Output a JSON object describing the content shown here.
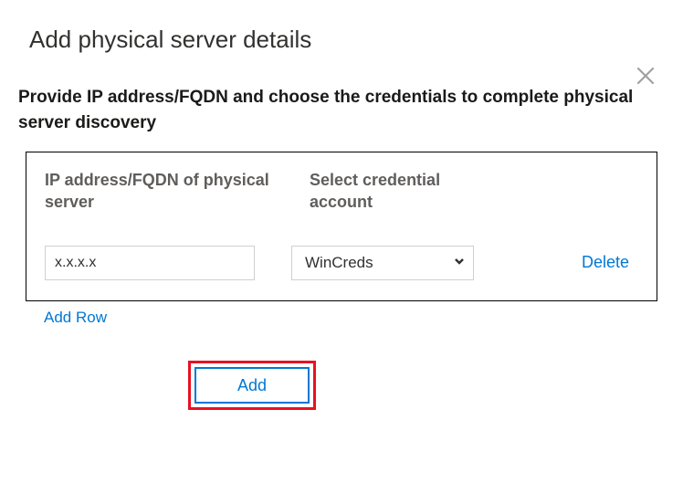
{
  "title": "Add physical server details",
  "description": "Provide IP address/FQDN and choose the credentials to complete physical server discovery",
  "table": {
    "headers": {
      "ip": "IP address/FQDN of physical server",
      "credential": "Select credential account"
    },
    "rows": [
      {
        "ip_value": "x.x.x.x",
        "credential_selected": "WinCreds",
        "delete_label": "Delete"
      }
    ]
  },
  "add_row_label": "Add Row",
  "add_button_label": "Add",
  "colors": {
    "link": "#0078d4",
    "highlight_border": "#e81123"
  }
}
